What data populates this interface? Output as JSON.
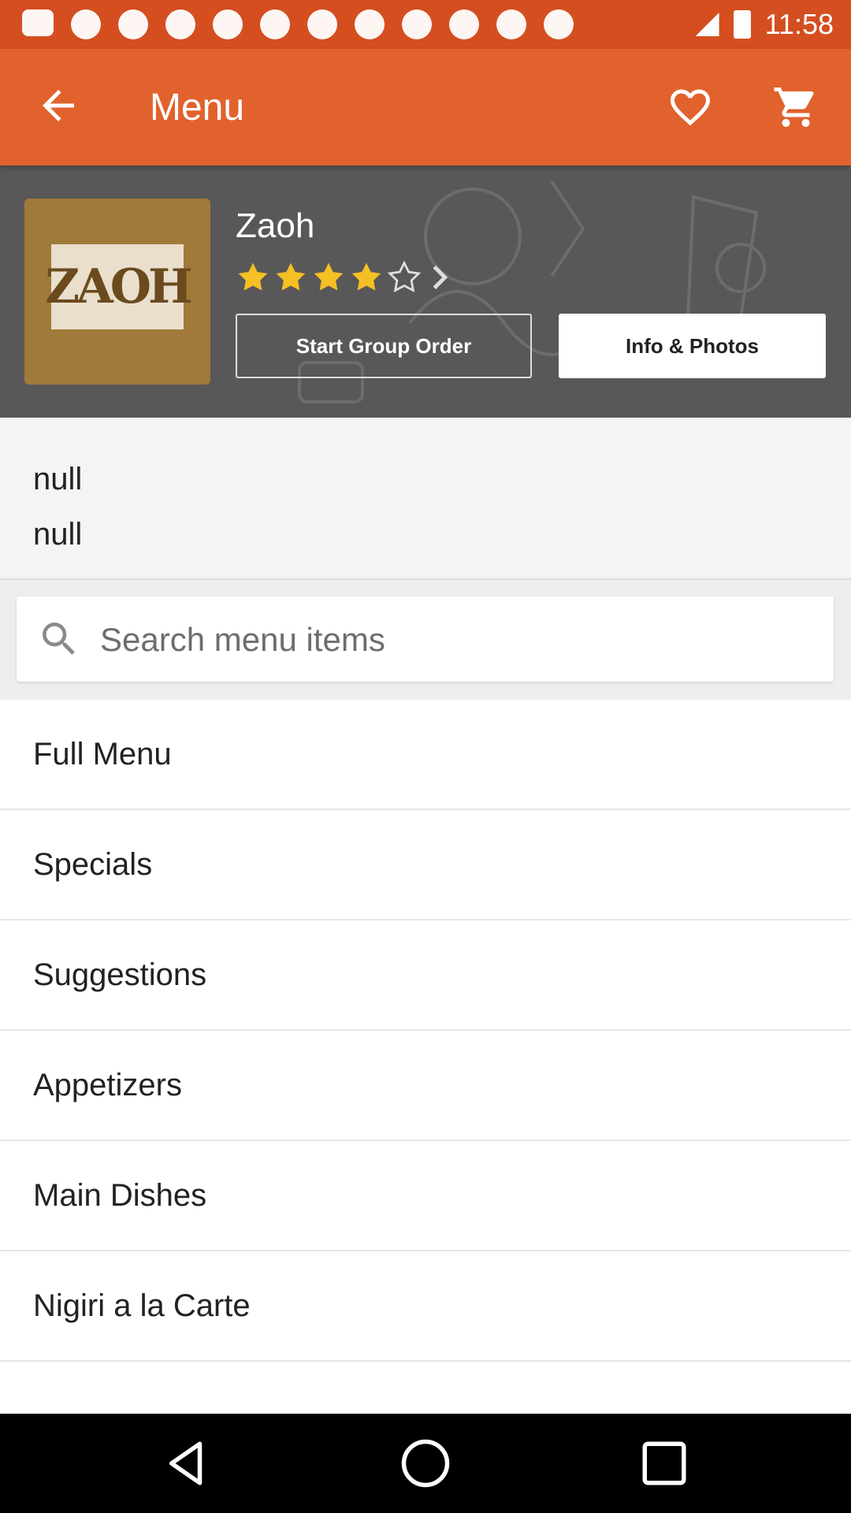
{
  "status_bar": {
    "time": "11:58"
  },
  "app_bar": {
    "title": "Menu"
  },
  "restaurant": {
    "name": "Zaoh",
    "logo_text": "ZAOH",
    "rating": 4,
    "rating_max": 5,
    "start_group_order_label": "Start Group Order",
    "info_photos_label": "Info & Photos"
  },
  "description": {
    "line1": "null",
    "line2": "null"
  },
  "search": {
    "placeholder": "Search menu items"
  },
  "menu": {
    "items": [
      {
        "label": "Full Menu"
      },
      {
        "label": "Specials"
      },
      {
        "label": "Suggestions"
      },
      {
        "label": "Appetizers"
      },
      {
        "label": "Main Dishes"
      },
      {
        "label": "Nigiri a la Carte"
      }
    ]
  },
  "colors": {
    "app_bar": "#e2622d",
    "status_bar": "#d44e20",
    "star": "#f5c024",
    "hero_bg": "#585858"
  },
  "icons": {
    "back": "arrow-left",
    "favorite": "heart-outline",
    "cart": "shopping-cart",
    "search": "magnifier",
    "nav_back": "triangle-back",
    "nav_home": "circle-home",
    "nav_recents": "square-recents"
  }
}
